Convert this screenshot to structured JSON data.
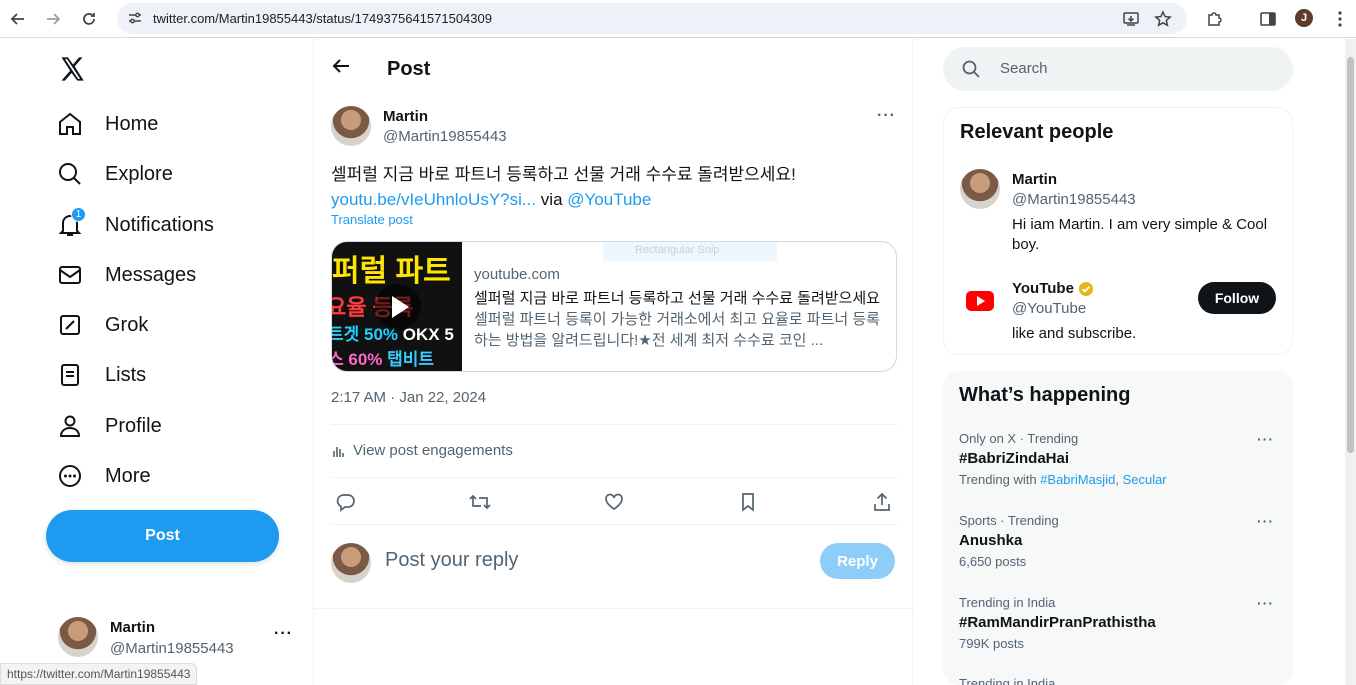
{
  "browser": {
    "url": "twitter.com/Martin19855443/status/1749375641571504309",
    "profile_initial": "J",
    "status_url": "https://twitter.com/Martin19855443"
  },
  "sidebar": {
    "items": [
      {
        "label": "Home",
        "icon": "home-icon"
      },
      {
        "label": "Explore",
        "icon": "search-icon"
      },
      {
        "label": "Notifications",
        "icon": "bell-icon",
        "badge": "1"
      },
      {
        "label": "Messages",
        "icon": "envelope-icon"
      },
      {
        "label": "Grok",
        "icon": "grok-icon"
      },
      {
        "label": "Lists",
        "icon": "list-icon"
      },
      {
        "label": "Profile",
        "icon": "person-icon"
      },
      {
        "label": "More",
        "icon": "more-circle-icon"
      }
    ],
    "post_button": "Post",
    "account": {
      "name": "Martin",
      "handle": "@Martin19855443",
      "more": "···"
    }
  },
  "main": {
    "header_title": "Post",
    "author": {
      "name": "Martin",
      "handle": "@Martin19855443"
    },
    "more": "···",
    "text": "셀퍼럴 지금 바로 파트너 등록하고 선물 거래 수수료 돌려받으세요!",
    "link_text": "youtu.be/vIeUhnloUsY?si...",
    "via_text": " via ",
    "mention": "@YouTube",
    "translate": "Translate post",
    "card": {
      "domain": "youtube.com",
      "title": "셀퍼럴 지금 바로 파트너 등록하고 선물 거래 수수료 돌려받으세요",
      "description": "셀퍼럴 파트너 등록이 가능한 거래소에서 최고 요율로 파트너 등록하는 방법을 알려드립니다!★전 세계 최저 수수료 코인 ...",
      "thumb_line1": "퍼럴 파트",
      "thumb_line2": "요율 등록",
      "thumb_line3a": "트겟 50%",
      "thumb_line3b": " OKX 5",
      "thumb_line4a": "스 60% ",
      "thumb_line4b": "탭비트"
    },
    "snip_overlay": "Rectangular Snip",
    "timestamp": "2:17 AM · Jan 22, 2024",
    "engagements": "View post engagements",
    "reply_placeholder": "Post your reply",
    "reply_button": "Reply"
  },
  "right": {
    "search_placeholder": "Search",
    "relevant_title": "Relevant people",
    "people": [
      {
        "name": "Martin",
        "handle": "@Martin19855443",
        "bio": "Hi iam Martin. I am very simple & Cool boy."
      },
      {
        "name": "YouTube",
        "handle": "@YouTube",
        "bio": "like and subscribe.",
        "follow": "Follow"
      }
    ],
    "happening_title": "What’s happening",
    "trends": [
      {
        "context": "Only on X · Trending",
        "title": "#BabriZindaHai",
        "sub_prefix": "Trending with ",
        "sub_link1": "#BabriMasjid",
        "sub_sep": ", ",
        "sub_link2": "Secular"
      },
      {
        "context": "Sports · Trending",
        "title": "Anushka",
        "sub": "6,650 posts"
      },
      {
        "context": "Trending in India",
        "title": "#RamMandirPranPrathistha",
        "sub": "799K posts"
      },
      {
        "context": "Trending in India"
      }
    ],
    "trend_more": "···"
  },
  "colors": {
    "accent": "#1d9bf0",
    "text": "#0f1419",
    "muted": "#536471"
  }
}
